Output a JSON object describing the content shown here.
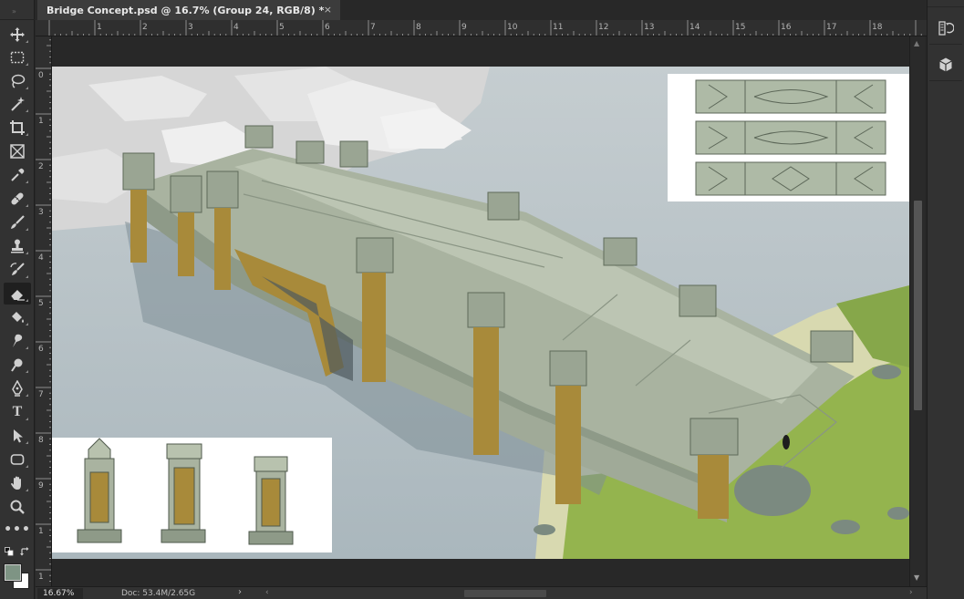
{
  "document": {
    "tab_title": "Bridge Concept.psd @ 16.7% (Group 24, RGB/8) *",
    "close_glyph": "×"
  },
  "toolbar": {
    "grip": "»",
    "tools": [
      {
        "name": "move-tool",
        "icon": "move-icon"
      },
      {
        "name": "rectangular-marquee-tool",
        "icon": "marquee-icon"
      },
      {
        "name": "lasso-tool",
        "icon": "lasso-icon"
      },
      {
        "name": "magic-wand-tool",
        "icon": "magic-wand-icon"
      },
      {
        "name": "crop-tool",
        "icon": "crop-icon"
      },
      {
        "name": "frame-tool",
        "icon": "frame-icon"
      },
      {
        "name": "eyedropper-tool",
        "icon": "eyedropper-icon"
      },
      {
        "name": "healing-brush-tool",
        "icon": "bandage-icon"
      },
      {
        "name": "brush-tool",
        "icon": "brush-icon"
      },
      {
        "name": "clone-stamp-tool",
        "icon": "stamp-icon"
      },
      {
        "name": "history-brush-tool",
        "icon": "history-brush-icon"
      },
      {
        "name": "eraser-tool",
        "icon": "eraser-icon",
        "active": true
      },
      {
        "name": "paint-bucket-tool",
        "icon": "paint-bucket-icon"
      },
      {
        "name": "smudge-tool",
        "icon": "smudge-icon"
      },
      {
        "name": "dodge-tool",
        "icon": "dodge-icon"
      },
      {
        "name": "pen-tool",
        "icon": "pen-icon"
      },
      {
        "name": "type-tool",
        "icon": "type-icon"
      },
      {
        "name": "path-selection-tool",
        "icon": "arrow-icon"
      },
      {
        "name": "rectangle-tool",
        "icon": "rectangle-icon"
      },
      {
        "name": "hand-tool",
        "icon": "hand-icon"
      },
      {
        "name": "zoom-tool",
        "icon": "zoom-icon"
      },
      {
        "name": "edit-toolbar",
        "icon": "more-icon"
      }
    ],
    "type_glyph": "T",
    "more_glyph": "•••",
    "foreground_color": "#7e9484",
    "background_color": "#ffffff"
  },
  "ruler_top": {
    "labels": [
      "1",
      "2",
      "3",
      "4",
      "5",
      "6",
      "7",
      "8",
      "9",
      "10",
      "11",
      "12",
      "13",
      "14",
      "15",
      "16",
      "17",
      "18"
    ]
  },
  "ruler_left": {
    "labels": [
      "0",
      "1",
      "2",
      "3",
      "4",
      "5",
      "6",
      "7",
      "8",
      "9",
      "1",
      "1"
    ]
  },
  "right_panel": {
    "buttons": [
      {
        "name": "history-panel-button",
        "icon": "history-icon"
      },
      {
        "name": "3d-panel-button",
        "icon": "cube-icon"
      }
    ]
  },
  "statusbar": {
    "zoom": "16.67%",
    "doc_info": "Doc: 53.4M/2.65G",
    "arrow": "›",
    "left_arrow": "‹",
    "right_arrow": "›"
  },
  "colors": {
    "water": "#b8c3c8",
    "stone": "#9faa96",
    "stone_light": "#b8c2ae",
    "trim_gold": "#a88a3a",
    "grass": "#8fb14a",
    "sand": "#d9d9b0",
    "city": "#d8d8d8"
  }
}
